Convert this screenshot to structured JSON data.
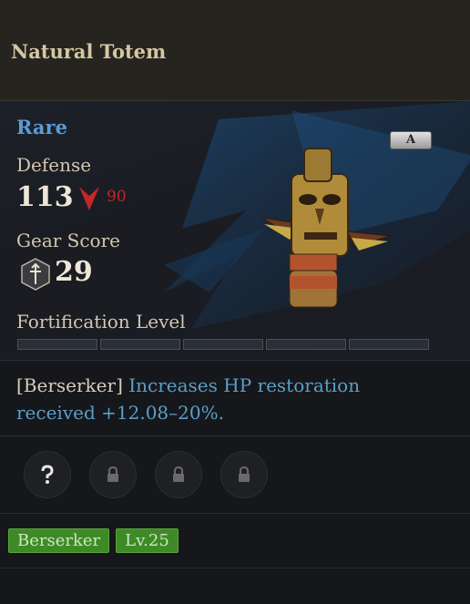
{
  "item": {
    "name": "Natural Totem",
    "rarity": "Rare",
    "grade": "A",
    "defense_label": "Defense",
    "defense_value": "113",
    "defense_diff": "90",
    "gear_score_label": "Gear Score",
    "gear_score_value": "29",
    "fortification_label": "Fortification Level",
    "fortification_filled": 0,
    "fortification_total": 5,
    "effect_class": "[Berserker]",
    "effect_text": "Increases HP restoration received +12.08–20%.",
    "sockets": [
      {
        "icon": "question-mark-icon"
      },
      {
        "icon": "lock-icon"
      },
      {
        "icon": "lock-icon"
      },
      {
        "icon": "lock-icon"
      }
    ],
    "tags": [
      "Berserker",
      "Lv.25"
    ]
  },
  "colors": {
    "rarity": "#5d9ad6",
    "effect": "#5a9fc8",
    "downgrade": "#c0282a",
    "badge": "#3e8a26"
  }
}
